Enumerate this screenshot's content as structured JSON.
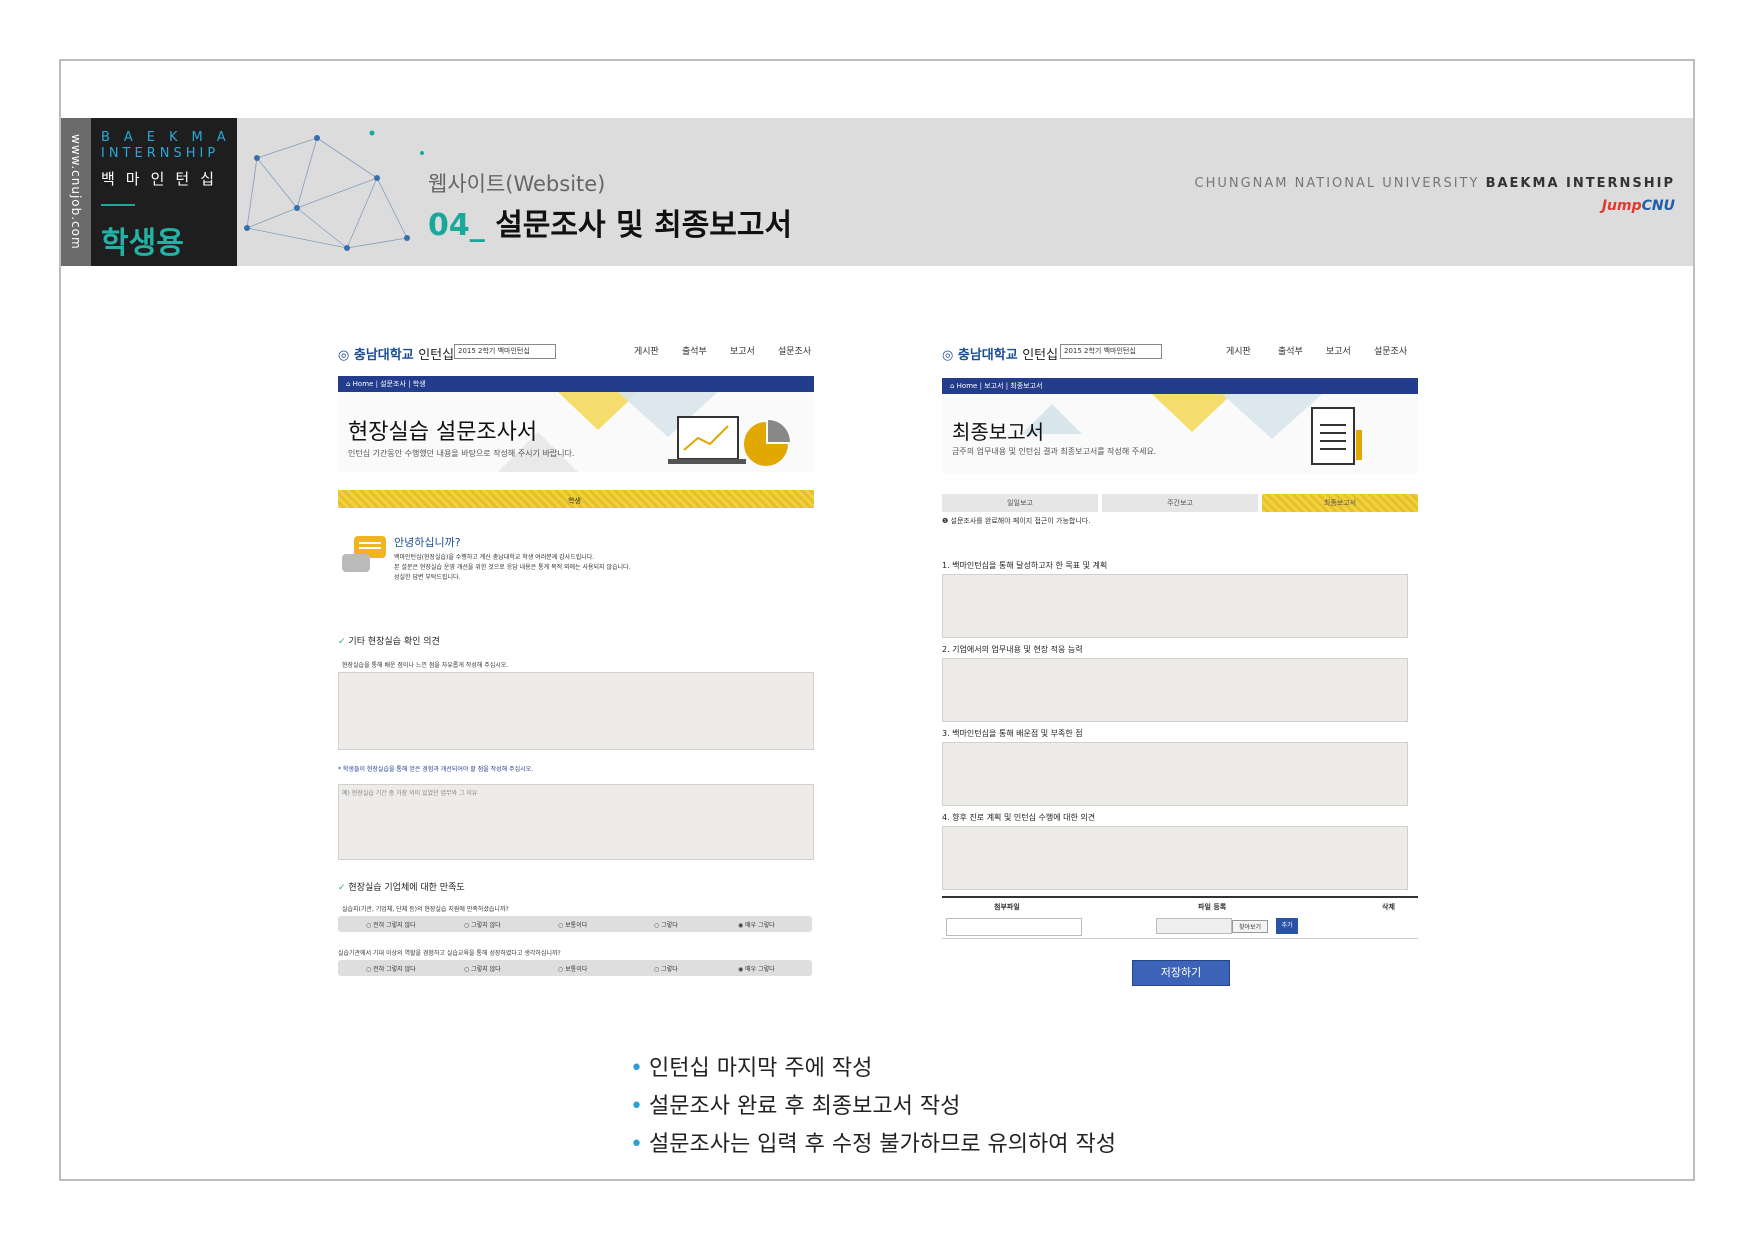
{
  "header": {
    "url": "www.cnujob.com",
    "badge_line1": "BAEKMA",
    "badge_line2": "INTERNSHIP",
    "badge_line3": "백마인턴십",
    "badge_audience": "학생용",
    "subtitle": "웹사이트(Website)",
    "title_num": "04_",
    "title_text": "설문조사 및 최종보고서",
    "university_prefix": "CHUNGNAM NATIONAL UNIVERSITY",
    "university_bold": "BAEKMA INTERNSHIP",
    "jump_logo": "Jump",
    "jump_logo_cnu": "CNU"
  },
  "survey_shot": {
    "logo": "충남대학교",
    "logo_suffix": "인턴십",
    "select_value": "2015 2학기 백마인턴십",
    "nav": [
      "게시판",
      "출석부",
      "보고서",
      "설문조사"
    ],
    "breadcrumb": "⌂ Home  |  설문조사  |  학생",
    "hero_title": "현장실습 설문조사서",
    "hero_desc": "인턴십 기간동안 수행했던 내용을 바탕으로 작성해 주시기 바랍니다.",
    "tab": "학생",
    "greeting": "안녕하십니까?",
    "intro1": "백마인턴십(현장실습)을 수행하고 계신 충남대학교 학생 여러분께 감사드립니다.",
    "intro2": "본 설문은 현장실습 운영 개선을 위한 것으로 응답 내용은 통계 목적 외에는 사용되지 않습니다.",
    "intro3": "성실한 답변 부탁드립니다.",
    "section1": "기타 현장실습 확인 의견",
    "q1": "현장실습을 통해 배운 점이나 느낀 점을 자유롭게 작성해 주십시오.",
    "q2_note": "* 학생들이 현장실습을 통해 얻은 경험과 개선되어야 할 점을 작성해 주십시오.",
    "q2_placeholder": "예) 현장실습 기간 중 가장 의미 있었던 업무와 그 이유",
    "section2": "현장실습 기업체에 대한 만족도",
    "q3": "실습지(기관, 기업체, 단체 등)의 현장실습 지원에 만족하셨습니까?",
    "q4": "실습기관에서 기대 이상의 역할을 경험하고 실습교육을 통해 성장하였다고 생각하십니까?",
    "options": [
      "전혀 그렇지 않다",
      "그렇지 않다",
      "보통이다",
      "그렇다",
      "매우 그렇다"
    ]
  },
  "report_shot": {
    "logo": "충남대학교",
    "logo_suffix": "인턴십",
    "select_value": "2015 2학기 백마인턴십",
    "nav": [
      "게시판",
      "출석부",
      "보고서",
      "설문조사"
    ],
    "breadcrumb": "⌂ Home  |  보고서  |  최종보고서",
    "hero_title": "최종보고서",
    "hero_desc": "금주의 업무내용 및 인턴십 결과 최종보고서를 작성해 주세요.",
    "tabs": [
      "일일보고",
      "주간보고",
      "최종보고서"
    ],
    "notice": "❶ 설문조사를 완료해야 페이지 접근이 가능합니다.",
    "questions": [
      "1. 백마인턴십을 통해 달성하고자 한 목표 및 계획",
      "2. 기업에서의 업무내용 및 현장 적응 능력",
      "3. 백마인턴십을 통해 배운점 및 부족한 점",
      "4. 향후 진로 계획 및 인턴십 수행에 대한 의견"
    ],
    "file_headers": [
      "첨부파일",
      "파일 등록",
      "삭제"
    ],
    "browse_label": "찾아보기",
    "add_label": "추가",
    "save_label": "저장하기"
  },
  "bullets": [
    "인턴십 마지막 주에 작성",
    "설문조사 완료 후 최종보고서 작성",
    "설문조사는 입력 후 수정 불가하므로 유의하여 작성"
  ]
}
